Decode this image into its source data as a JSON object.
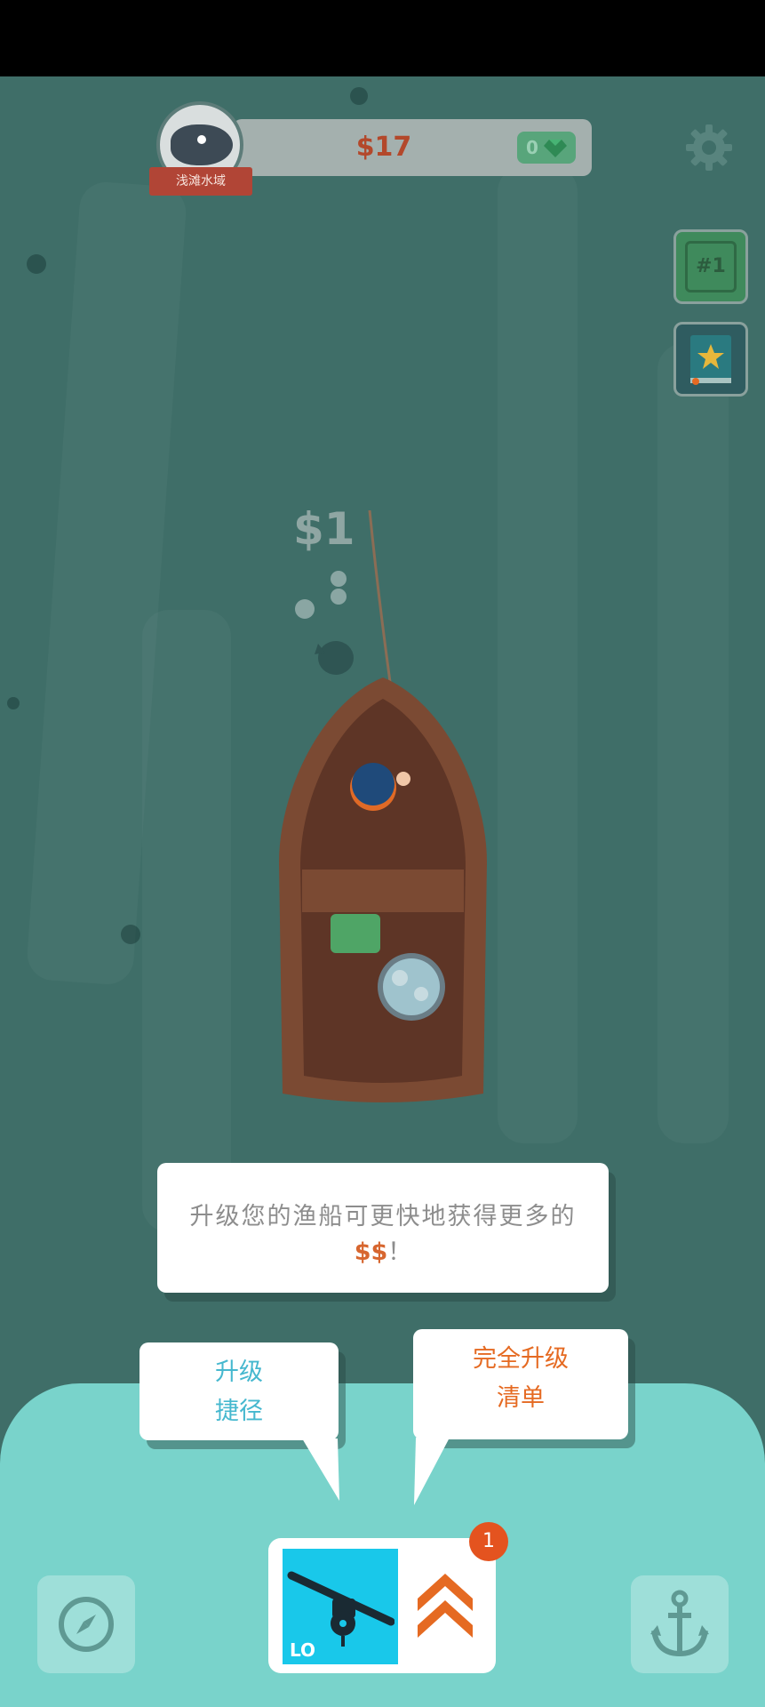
{
  "header": {
    "region_label": "浅滩水域",
    "money": "$17",
    "gems": "0"
  },
  "side_buttons": {
    "rank_label": "#1"
  },
  "catch": {
    "floating_money": "$1"
  },
  "tooltips": {
    "upgrade_boat_line1": "升级您的渔船可更快地获得更多的",
    "upgrade_boat_money": "$$",
    "upgrade_boat_suffix": "！",
    "shortcut_line1": "升级",
    "shortcut_line2": "捷径",
    "full_list_line1": "完全升级",
    "full_list_line2": "清单"
  },
  "upgrade_card": {
    "rod_level": "LO",
    "badge_count": "1"
  },
  "colors": {
    "water": "#3f6e68",
    "panel": "#79d3cb",
    "accent_orange": "#e56a22",
    "tile_blue": "#19c8ea"
  }
}
